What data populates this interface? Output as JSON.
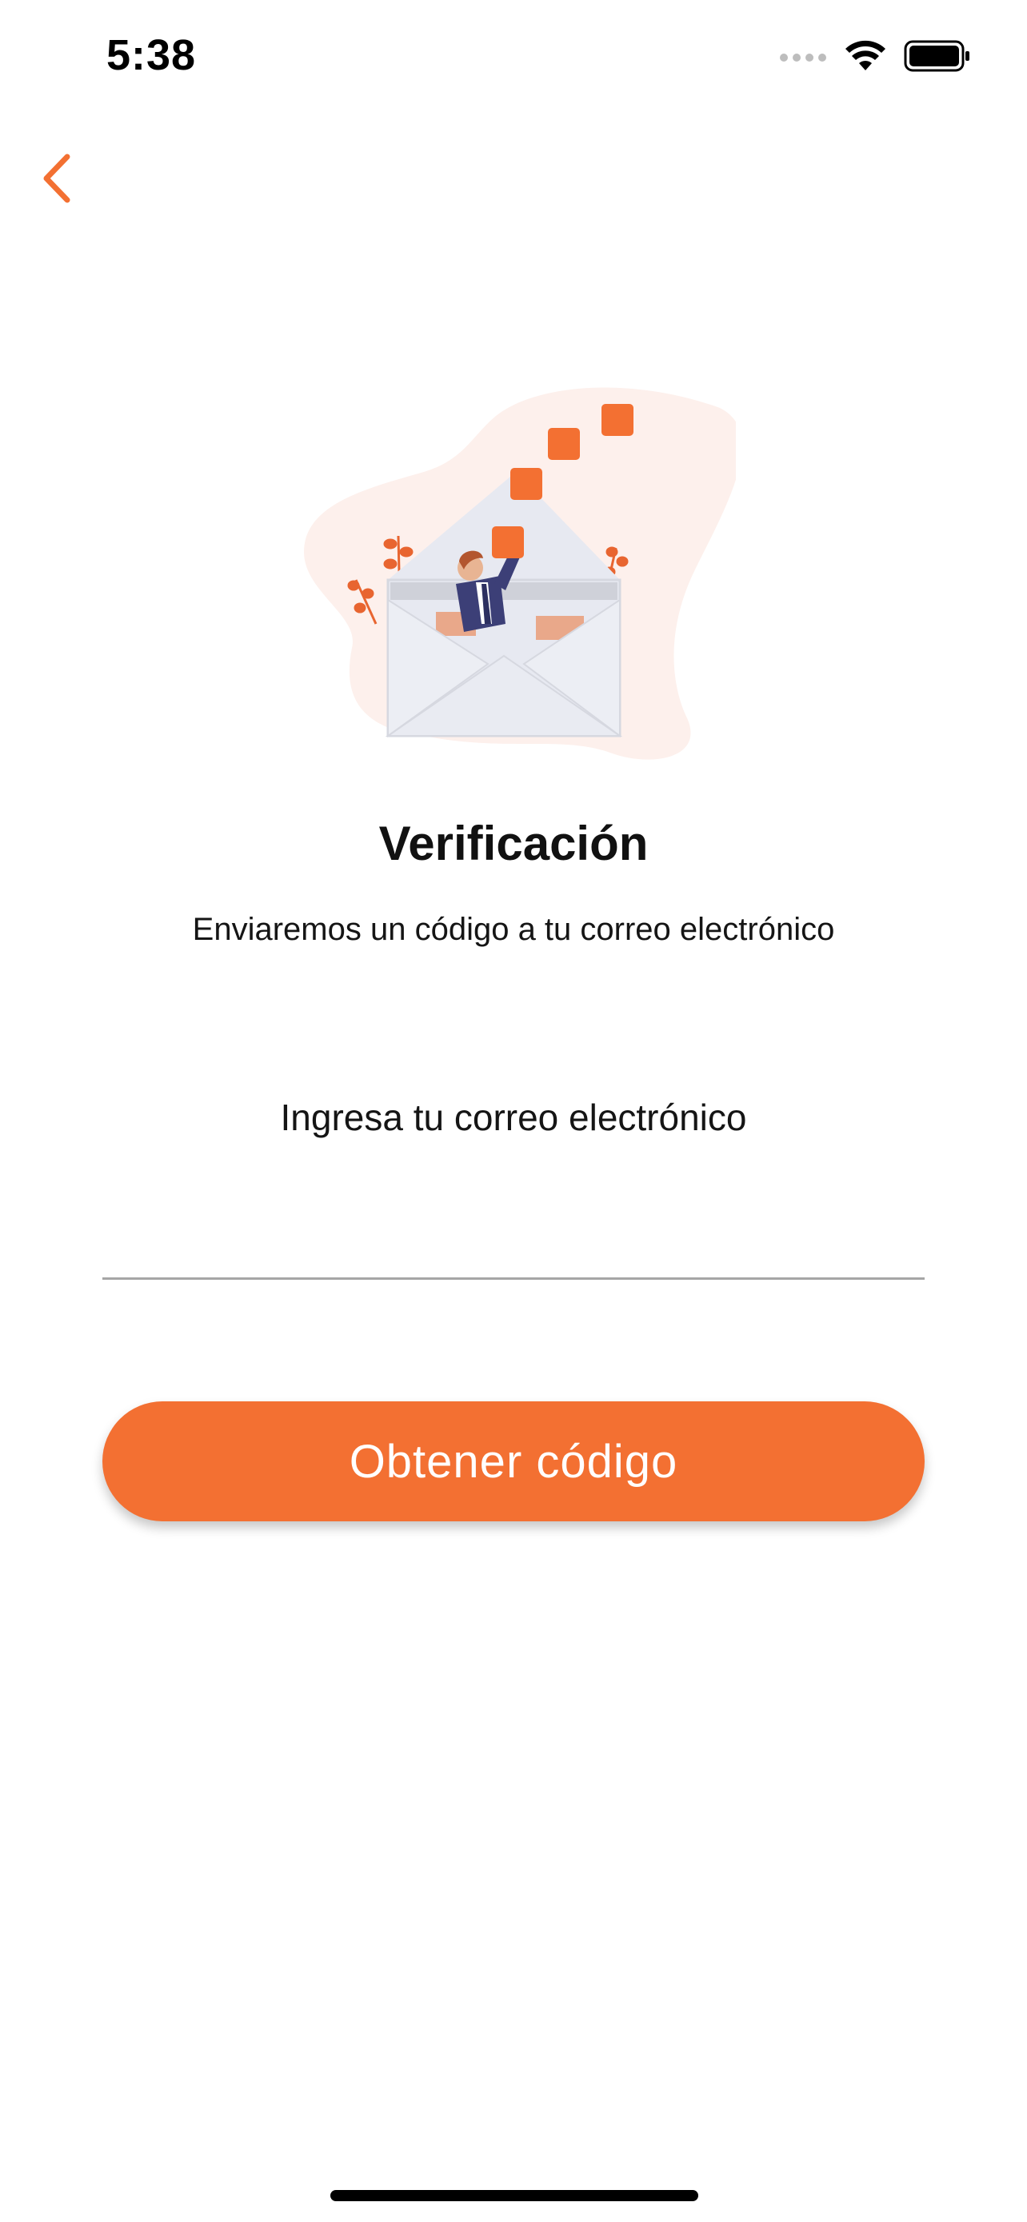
{
  "status_bar": {
    "time": "5:38",
    "icons": [
      "signal-icon",
      "wifi-icon",
      "battery-icon"
    ]
  },
  "nav": {
    "back_icon": "chevron-left-icon"
  },
  "illustration": {
    "icon": "mail-verification-illustration"
  },
  "content": {
    "title": "Verificación",
    "subtitle": "Enviaremos un código a tu correo electrónico",
    "email_label": "Ingresa tu correo electrónico",
    "email_value": ""
  },
  "actions": {
    "primary_label": "Obtener código"
  },
  "colors": {
    "accent": "#f37032",
    "blob": "#fdf0ec",
    "envelope": "#e7e9f1",
    "suit": "#3c3f77",
    "divider": "#a6a6a6"
  }
}
